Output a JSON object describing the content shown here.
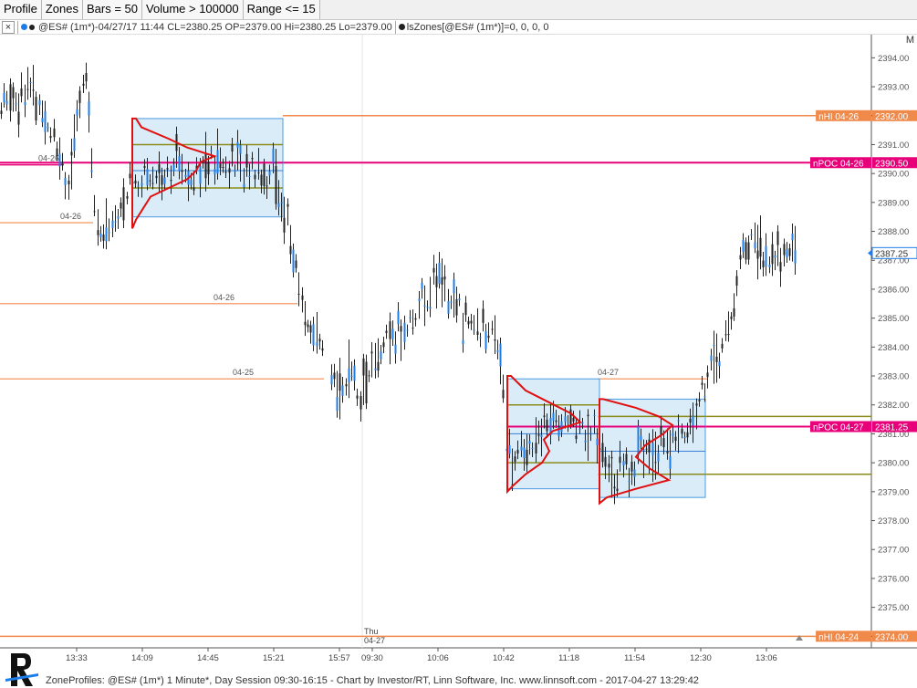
{
  "toolbar": {
    "buttons": [
      "Profile",
      "Zones",
      "Bars = 50",
      "Volume > 100000",
      "Range <= 15"
    ]
  },
  "infobar": {
    "close": "×",
    "symbol_text": "@ES# (1m*)-04/27/17 11:44 CL=2380.25 OP=2379.00 Hi=2380.25 Lo=2379.00",
    "study_text": "lsZones[@ES# (1m*)]=0, 0, 0, 0",
    "m_label": "M"
  },
  "colors": {
    "orange": "#f08a4b",
    "magenta": "#e8007a",
    "olive": "#8b8b1c",
    "blue": "#3a7fd6",
    "red": "#e01010",
    "box_fill": "#cfe5f7",
    "box_stroke": "#4a9be0",
    "price_blue": "#1e7ce8"
  },
  "chart_data": {
    "type": "candlestick",
    "ylim": [
      2373.6,
      2394.8
    ],
    "y_ticks": [
      2394,
      2393,
      2392,
      2391,
      2390,
      2389,
      2388,
      2387,
      2386,
      2385,
      2384,
      2383,
      2382,
      2381,
      2380,
      2379,
      2378,
      2377,
      2376,
      2375,
      2374
    ],
    "x_ticks": [
      "13:33",
      "14:09",
      "14:45",
      "15:21",
      "15:57",
      "09:30",
      "10:06",
      "10:42",
      "11:18",
      "11:54",
      "12:30",
      "13:06"
    ],
    "session_label": "Thu 04-27",
    "last_price": "2387.25",
    "price_lines": [
      {
        "label": "nHI 04-26",
        "price": "2392.00",
        "value": 2392.0,
        "kind": "orange",
        "tag": true
      },
      {
        "label": "nPOC 04-26",
        "price": "2390.50",
        "value": 2390.375,
        "kind": "magenta",
        "tag": true
      },
      {
        "label": "nPOC 04-27",
        "price": "2381.25",
        "value": 2381.25,
        "kind": "magenta",
        "tag": true
      },
      {
        "label": "nHI 04-24",
        "price": "2374.00",
        "value": 2374.0,
        "kind": "orange",
        "tag": true
      }
    ],
    "segment_labels": [
      {
        "text": "04-26",
        "value": 2390.3
      },
      {
        "text": "04-26",
        "value": 2388.3
      },
      {
        "text": "04-26",
        "value": 2385.5
      },
      {
        "text": "04-25",
        "value": 2382.9
      },
      {
        "text": "04-27",
        "value": 2382.9
      }
    ],
    "zones": [
      {
        "name": "zone-1",
        "price_top": 2391.9,
        "price_bottom": 2388.5,
        "poc": 2390.375,
        "val_hi": 2391.0,
        "val_lo": 2389.5,
        "mid": 2390.1
      },
      {
        "name": "zone-2",
        "price_top": 2382.9,
        "price_bottom": 2379.1,
        "poc": 2381.25,
        "val_hi": 2382.0,
        "val_lo": 2380.0,
        "mid": 2381.0
      },
      {
        "name": "zone-3",
        "price_top": 2382.2,
        "price_bottom": 2378.8,
        "poc": 2381.25,
        "val_hi": 2381.6,
        "val_lo": 2379.6,
        "mid": 2380.4
      }
    ]
  },
  "footer": {
    "text": "ZoneProfiles: @ES# (1m*) 1 Minute*, Day Session 09:30-16:15 - Chart by Investor/RT, Linn Software, Inc. www.linnsoft.com - 2017-04-27 13:29:42"
  }
}
